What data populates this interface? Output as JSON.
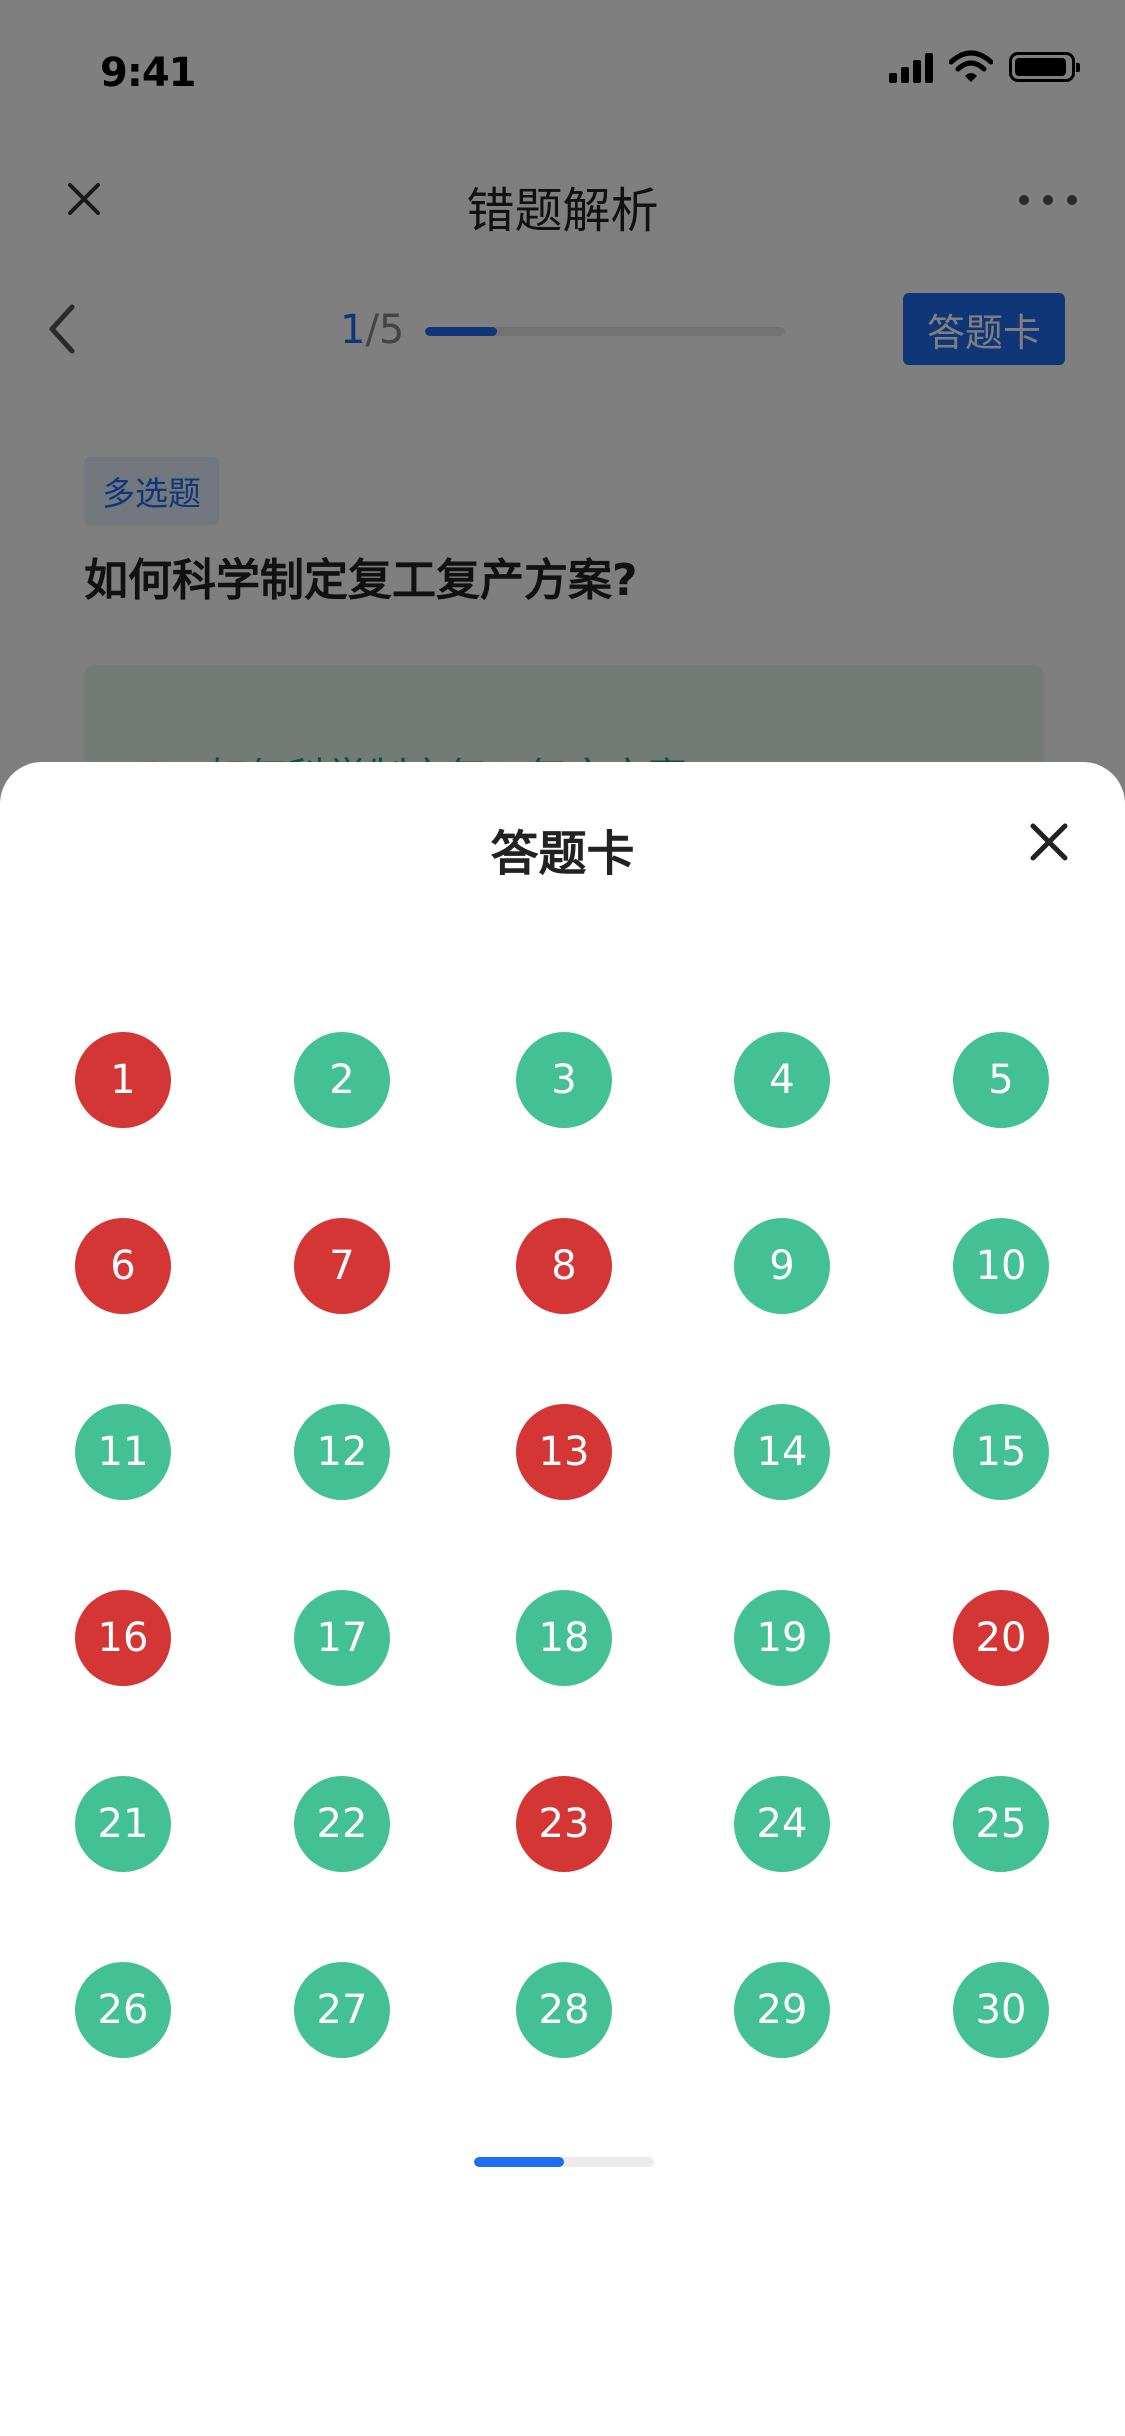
{
  "status_bar": {
    "time": "9:41"
  },
  "nav": {
    "title": "错题解析"
  },
  "progress": {
    "current": "1",
    "separator_total": "/5",
    "fraction": 0.2,
    "card_button": "答题卡"
  },
  "question": {
    "type_tag": "多选题",
    "text": "如何科学制定复工复产方案?",
    "option_preview": "A　如何科学制定复工复产方案"
  },
  "sheet": {
    "title": "答题卡",
    "questions": [
      {
        "num": "1",
        "status": "wrong"
      },
      {
        "num": "2",
        "status": "correct"
      },
      {
        "num": "3",
        "status": "correct"
      },
      {
        "num": "4",
        "status": "correct"
      },
      {
        "num": "5",
        "status": "correct"
      },
      {
        "num": "6",
        "status": "wrong"
      },
      {
        "num": "7",
        "status": "wrong"
      },
      {
        "num": "8",
        "status": "wrong"
      },
      {
        "num": "9",
        "status": "correct"
      },
      {
        "num": "10",
        "status": "correct"
      },
      {
        "num": "11",
        "status": "correct"
      },
      {
        "num": "12",
        "status": "correct"
      },
      {
        "num": "13",
        "status": "wrong"
      },
      {
        "num": "14",
        "status": "correct"
      },
      {
        "num": "15",
        "status": "correct"
      },
      {
        "num": "16",
        "status": "wrong"
      },
      {
        "num": "17",
        "status": "correct"
      },
      {
        "num": "18",
        "status": "correct"
      },
      {
        "num": "19",
        "status": "correct"
      },
      {
        "num": "20",
        "status": "wrong"
      },
      {
        "num": "21",
        "status": "correct"
      },
      {
        "num": "22",
        "status": "correct"
      },
      {
        "num": "23",
        "status": "wrong"
      },
      {
        "num": "24",
        "status": "correct"
      },
      {
        "num": "25",
        "status": "correct"
      },
      {
        "num": "26",
        "status": "correct"
      },
      {
        "num": "27",
        "status": "correct"
      },
      {
        "num": "28",
        "status": "correct"
      },
      {
        "num": "29",
        "status": "correct"
      },
      {
        "num": "30",
        "status": "correct"
      }
    ],
    "page_fraction": 0.5
  },
  "colors": {
    "accent": "#1f6ef0",
    "correct": "#44c095",
    "wrong": "#d43636"
  },
  "icons": [
    "signal-icon",
    "wifi-icon",
    "battery-icon",
    "close-icon",
    "more-icon",
    "chevron-left-icon"
  ]
}
